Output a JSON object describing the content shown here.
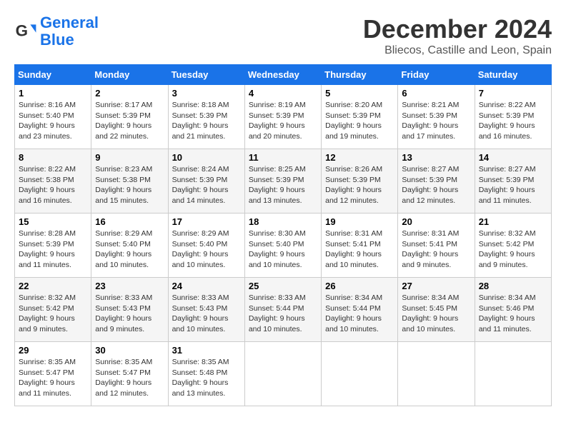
{
  "logo": {
    "line1": "General",
    "line2": "Blue"
  },
  "header": {
    "month": "December 2024",
    "location": "Bliecos, Castille and Leon, Spain"
  },
  "weekdays": [
    "Sunday",
    "Monday",
    "Tuesday",
    "Wednesday",
    "Thursday",
    "Friday",
    "Saturday"
  ],
  "weeks": [
    [
      {
        "day": "1",
        "sunrise": "8:16 AM",
        "sunset": "5:40 PM",
        "daylight": "9 hours and 23 minutes."
      },
      {
        "day": "2",
        "sunrise": "8:17 AM",
        "sunset": "5:39 PM",
        "daylight": "9 hours and 22 minutes."
      },
      {
        "day": "3",
        "sunrise": "8:18 AM",
        "sunset": "5:39 PM",
        "daylight": "9 hours and 21 minutes."
      },
      {
        "day": "4",
        "sunrise": "8:19 AM",
        "sunset": "5:39 PM",
        "daylight": "9 hours and 20 minutes."
      },
      {
        "day": "5",
        "sunrise": "8:20 AM",
        "sunset": "5:39 PM",
        "daylight": "9 hours and 19 minutes."
      },
      {
        "day": "6",
        "sunrise": "8:21 AM",
        "sunset": "5:39 PM",
        "daylight": "9 hours and 17 minutes."
      },
      {
        "day": "7",
        "sunrise": "8:22 AM",
        "sunset": "5:39 PM",
        "daylight": "9 hours and 16 minutes."
      }
    ],
    [
      {
        "day": "8",
        "sunrise": "8:22 AM",
        "sunset": "5:38 PM",
        "daylight": "9 hours and 16 minutes."
      },
      {
        "day": "9",
        "sunrise": "8:23 AM",
        "sunset": "5:38 PM",
        "daylight": "9 hours and 15 minutes."
      },
      {
        "day": "10",
        "sunrise": "8:24 AM",
        "sunset": "5:39 PM",
        "daylight": "9 hours and 14 minutes."
      },
      {
        "day": "11",
        "sunrise": "8:25 AM",
        "sunset": "5:39 PM",
        "daylight": "9 hours and 13 minutes."
      },
      {
        "day": "12",
        "sunrise": "8:26 AM",
        "sunset": "5:39 PM",
        "daylight": "9 hours and 12 minutes."
      },
      {
        "day": "13",
        "sunrise": "8:27 AM",
        "sunset": "5:39 PM",
        "daylight": "9 hours and 12 minutes."
      },
      {
        "day": "14",
        "sunrise": "8:27 AM",
        "sunset": "5:39 PM",
        "daylight": "9 hours and 11 minutes."
      }
    ],
    [
      {
        "day": "15",
        "sunrise": "8:28 AM",
        "sunset": "5:39 PM",
        "daylight": "9 hours and 11 minutes."
      },
      {
        "day": "16",
        "sunrise": "8:29 AM",
        "sunset": "5:40 PM",
        "daylight": "9 hours and 10 minutes."
      },
      {
        "day": "17",
        "sunrise": "8:29 AM",
        "sunset": "5:40 PM",
        "daylight": "9 hours and 10 minutes."
      },
      {
        "day": "18",
        "sunrise": "8:30 AM",
        "sunset": "5:40 PM",
        "daylight": "9 hours and 10 minutes."
      },
      {
        "day": "19",
        "sunrise": "8:31 AM",
        "sunset": "5:41 PM",
        "daylight": "9 hours and 10 minutes."
      },
      {
        "day": "20",
        "sunrise": "8:31 AM",
        "sunset": "5:41 PM",
        "daylight": "9 hours and 9 minutes."
      },
      {
        "day": "21",
        "sunrise": "8:32 AM",
        "sunset": "5:42 PM",
        "daylight": "9 hours and 9 minutes."
      }
    ],
    [
      {
        "day": "22",
        "sunrise": "8:32 AM",
        "sunset": "5:42 PM",
        "daylight": "9 hours and 9 minutes."
      },
      {
        "day": "23",
        "sunrise": "8:33 AM",
        "sunset": "5:43 PM",
        "daylight": "9 hours and 9 minutes."
      },
      {
        "day": "24",
        "sunrise": "8:33 AM",
        "sunset": "5:43 PM",
        "daylight": "9 hours and 10 minutes."
      },
      {
        "day": "25",
        "sunrise": "8:33 AM",
        "sunset": "5:44 PM",
        "daylight": "9 hours and 10 minutes."
      },
      {
        "day": "26",
        "sunrise": "8:34 AM",
        "sunset": "5:44 PM",
        "daylight": "9 hours and 10 minutes."
      },
      {
        "day": "27",
        "sunrise": "8:34 AM",
        "sunset": "5:45 PM",
        "daylight": "9 hours and 10 minutes."
      },
      {
        "day": "28",
        "sunrise": "8:34 AM",
        "sunset": "5:46 PM",
        "daylight": "9 hours and 11 minutes."
      }
    ],
    [
      {
        "day": "29",
        "sunrise": "8:35 AM",
        "sunset": "5:47 PM",
        "daylight": "9 hours and 11 minutes."
      },
      {
        "day": "30",
        "sunrise": "8:35 AM",
        "sunset": "5:47 PM",
        "daylight": "9 hours and 12 minutes."
      },
      {
        "day": "31",
        "sunrise": "8:35 AM",
        "sunset": "5:48 PM",
        "daylight": "9 hours and 13 minutes."
      },
      null,
      null,
      null,
      null
    ]
  ]
}
